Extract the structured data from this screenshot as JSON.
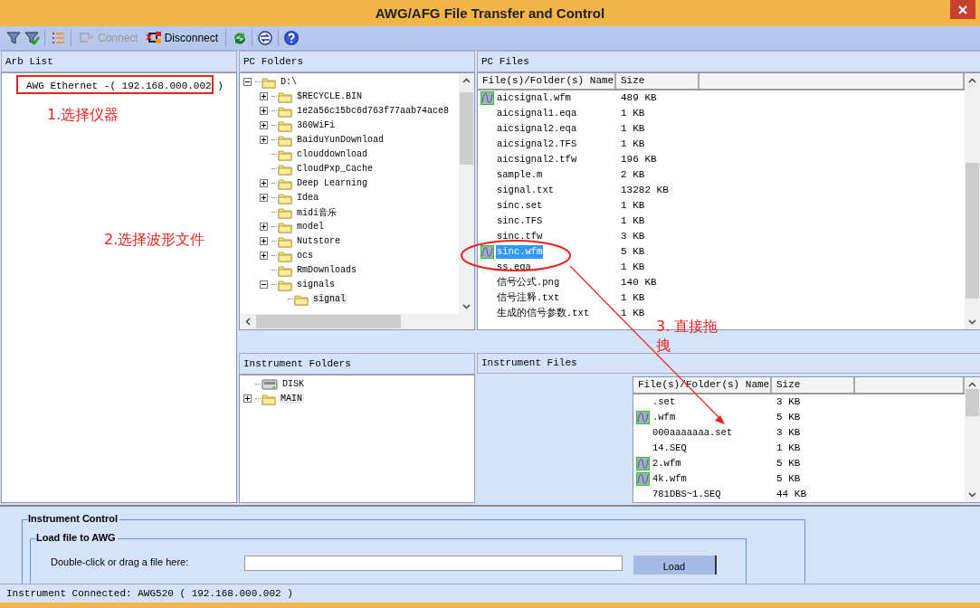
{
  "window": {
    "title": "AWG/AFG File Transfer and Control"
  },
  "toolbar": [
    {
      "kind": "filter",
      "disabled": false
    },
    {
      "kind": "filter-check",
      "disabled": false
    },
    {
      "kind": "sep"
    },
    {
      "kind": "list",
      "disabled": false
    },
    {
      "kind": "sep"
    },
    {
      "kind": "connect",
      "label": "Connect",
      "disabled": true
    },
    {
      "kind": "disconnect",
      "label": "Disconnect",
      "disabled": false
    },
    {
      "kind": "sep"
    },
    {
      "kind": "refresh",
      "disabled": false
    },
    {
      "kind": "sep"
    },
    {
      "kind": "sync",
      "disabled": false
    },
    {
      "kind": "sep"
    },
    {
      "kind": "help",
      "disabled": false
    }
  ],
  "arb_list": {
    "title": "Arb List",
    "items": [
      {
        "label": "AWG Ethernet -( 192.168.000.002 )",
        "selected": false
      }
    ]
  },
  "pc_folders": {
    "title": "PC Folders",
    "tree": [
      {
        "label": "D:\\",
        "expandable": true,
        "expanded": true,
        "selected": false,
        "children": [
          {
            "label": "$RECYCLE.BIN",
            "expandable": true,
            "expanded": false,
            "selected": false
          },
          {
            "label": "1e2a56c15bc6d763f77aab74ace8",
            "expandable": true,
            "expanded": false,
            "selected": false
          },
          {
            "label": "360WiFi",
            "expandable": true,
            "expanded": false,
            "selected": false
          },
          {
            "label": "BaiduYunDownload",
            "expandable": true,
            "expanded": false,
            "selected": false
          },
          {
            "label": "clouddownload",
            "expandable": false,
            "selected": false
          },
          {
            "label": "CloudPxp_Cache",
            "expandable": false,
            "selected": false
          },
          {
            "label": "Deep Learning",
            "expandable": true,
            "expanded": false,
            "selected": false
          },
          {
            "label": "Idea",
            "expandable": true,
            "expanded": false,
            "selected": false
          },
          {
            "label": "midi音乐",
            "expandable": false,
            "selected": false
          },
          {
            "label": "model",
            "expandable": true,
            "expanded": false,
            "selected": false
          },
          {
            "label": "Nutstore",
            "expandable": true,
            "expanded": false,
            "selected": false
          },
          {
            "label": "ocs",
            "expandable": true,
            "expanded": false,
            "selected": false
          },
          {
            "label": "RmDownloads",
            "expandable": false,
            "selected": false
          },
          {
            "label": "signals",
            "expandable": true,
            "expanded": true,
            "selected": false,
            "children": [
              {
                "label": "signal",
                "expandable": false,
                "selected": true
              }
            ]
          }
        ]
      }
    ]
  },
  "pc_files": {
    "title": "PC Files",
    "columns": [
      "File(s)/Folder(s) Name",
      "Size"
    ],
    "rows": [
      {
        "name": "aicsignal.wfm",
        "size": "489 KB",
        "kind": "waveform",
        "selected": false
      },
      {
        "name": "aicsignal1.eqa",
        "size": "1 KB",
        "kind": "file",
        "selected": false
      },
      {
        "name": "aicsignal2.eqa",
        "size": "1 KB",
        "kind": "file",
        "selected": false
      },
      {
        "name": "aicsignal2.TFS",
        "size": "1 KB",
        "kind": "file",
        "selected": false
      },
      {
        "name": "aicsignal2.tfw",
        "size": "196 KB",
        "kind": "file",
        "selected": false
      },
      {
        "name": "sample.m",
        "size": "2 KB",
        "kind": "file",
        "selected": false
      },
      {
        "name": "signal.txt",
        "size": "13282 KB",
        "kind": "file",
        "selected": false
      },
      {
        "name": "sinc.set",
        "size": "1 KB",
        "kind": "file",
        "selected": false
      },
      {
        "name": "sinc.TFS",
        "size": "1 KB",
        "kind": "file",
        "selected": false
      },
      {
        "name": "sinc.tfw",
        "size": "3 KB",
        "kind": "file",
        "selected": false
      },
      {
        "name": "sinc.wfm",
        "size": "5 KB",
        "kind": "waveform",
        "selected": true
      },
      {
        "name": "ss.eqa",
        "size": "1 KB",
        "kind": "file",
        "selected": false
      },
      {
        "name": "信号公式.png",
        "size": "140 KB",
        "kind": "file",
        "selected": false
      },
      {
        "name": "信号注释.txt",
        "size": "1 KB",
        "kind": "file",
        "selected": false
      },
      {
        "name": "生成的信号参数.txt",
        "size": "1 KB",
        "kind": "file",
        "selected": false
      }
    ]
  },
  "instrument_folders": {
    "title": "Instrument Folders",
    "tree": [
      {
        "label": "DISK",
        "kind": "drive",
        "expandable": false,
        "selected": false
      },
      {
        "label": "MAIN",
        "kind": "folder",
        "expandable": true,
        "expanded": false,
        "selected": true
      }
    ]
  },
  "instrument_files": {
    "title": "Instrument Files",
    "columns": [
      "File(s)/Folder(s) Name",
      "Size"
    ],
    "rows": [
      {
        "name": ".set",
        "size": "3 KB",
        "kind": "file",
        "selected": false
      },
      {
        "name": ".wfm",
        "size": "5 KB",
        "kind": "waveform",
        "selected": false
      },
      {
        "name": "000aaaaaaa.set",
        "size": "3 KB",
        "kind": "file",
        "selected": false
      },
      {
        "name": "14.SEQ",
        "size": "1 KB",
        "kind": "file",
        "selected": false
      },
      {
        "name": "2.wfm",
        "size": "5 KB",
        "kind": "waveform",
        "selected": false
      },
      {
        "name": "4k.wfm",
        "size": "5 KB",
        "kind": "waveform",
        "selected": false
      },
      {
        "name": "781DBS~1.SEQ",
        "size": "44 KB",
        "kind": "file",
        "selected": false
      }
    ]
  },
  "instrument_control": {
    "title": "Instrument Control",
    "group": {
      "title": "Load file to AWG",
      "label": "Double-click or drag a file here:",
      "button": "Load"
    }
  },
  "status_bar": {
    "text": "Instrument Connected: AWG520 ( 192.168.000.002 )"
  },
  "annotations": [
    {
      "kind": "box"
    },
    {
      "kind": "text",
      "text": "1.选择仪器"
    },
    {
      "kind": "text",
      "text": "2.选择波形文件"
    },
    {
      "kind": "ellipse"
    },
    {
      "kind": "arrow"
    },
    {
      "kind": "text",
      "text": "3. 直接拖拽"
    }
  ]
}
